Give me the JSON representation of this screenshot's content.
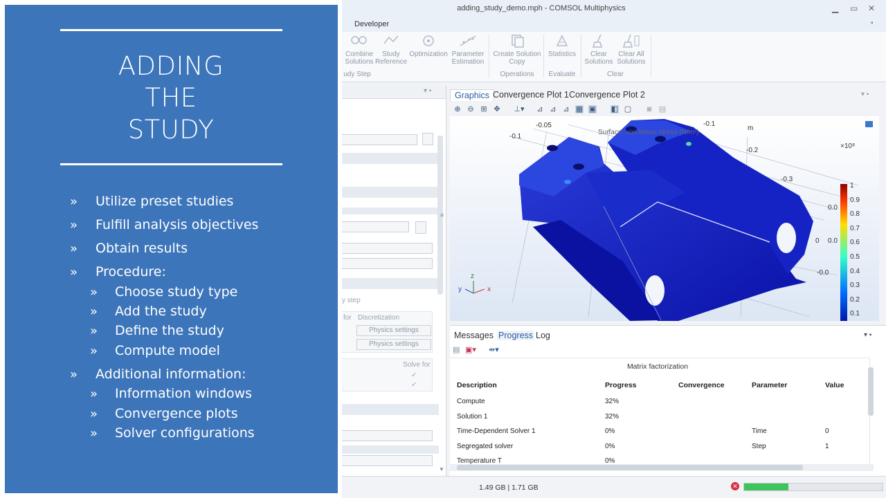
{
  "slide": {
    "title_lines": [
      "ADDING",
      "THE",
      "STUDY"
    ],
    "bullets": [
      {
        "text": "Utilize preset studies",
        "level": 0
      },
      {
        "text": "Fulfill analysis objectives",
        "level": 0
      },
      {
        "text": "Obtain results",
        "level": 0
      },
      {
        "text": "Procedure:",
        "level": 0
      },
      {
        "text": "Choose study type",
        "level": 1
      },
      {
        "text": "Add the study",
        "level": 1
      },
      {
        "text": "Define the study",
        "level": 1
      },
      {
        "text": "Compute model",
        "level": 1
      },
      {
        "text": "Additional information:",
        "level": 0
      },
      {
        "text": "Information windows",
        "level": 1
      },
      {
        "text": "Convergence plots",
        "level": 1
      },
      {
        "text": "Solver configurations",
        "level": 1
      }
    ],
    "bullet_glyph": "»"
  },
  "app": {
    "window_title": "adding_study_demo.mph - COMSOL Multiphysics",
    "ribbon_tab": "Developer",
    "ribbon": {
      "study_step": {
        "group": "udy Step",
        "buttons": [
          "Combine Solutions",
          "Study Reference",
          "Optimization",
          "Parameter Estimation"
        ]
      },
      "operations": {
        "group": "Operations",
        "buttons": [
          "Create Solution Copy"
        ]
      },
      "evaluate": {
        "group": "Evaluate",
        "buttons": [
          "Statistics"
        ]
      },
      "clear": {
        "group": "Clear",
        "buttons": [
          "Clear Solutions",
          "Clear All Solutions"
        ]
      }
    },
    "left_pane": {
      "section_label": "y step",
      "col_for": "for",
      "col_discretization": "Discretization",
      "physics_settings": [
        "Physics settings",
        "Physics settings"
      ],
      "solve_for": "Solve for"
    },
    "graphics": {
      "tabs": [
        "Graphics",
        "Convergence Plot 1",
        "Convergence Plot 2"
      ],
      "active_tab": "Graphics",
      "plot_title": "Surface: von Mises stress (N/m²)",
      "axis_unit": "m",
      "axis_labels": [
        "-0.05",
        "-0.1",
        "-0.1",
        "-0.2",
        "-0.3",
        "0",
        "-0.0",
        "0.0",
        "0.0"
      ],
      "colorbar": {
        "exponent": "×10⁸",
        "ticks": [
          "1",
          "0.9",
          "0.8",
          "0.7",
          "0.6",
          "0.5",
          "0.4",
          "0.3",
          "0.2",
          "0.1"
        ]
      },
      "triad": {
        "x": "x",
        "y": "y",
        "z": "z"
      }
    },
    "progress": {
      "tabs": [
        "Messages",
        "Progress",
        "Log"
      ],
      "active_tab": "Progress",
      "caption": "Matrix factorization",
      "columns": [
        "Description",
        "Progress",
        "Convergence",
        "Parameter",
        "Value"
      ],
      "rows": [
        [
          "Compute",
          "32%",
          "",
          "",
          ""
        ],
        [
          "Solution 1",
          "32%",
          "",
          "",
          ""
        ],
        [
          "Time-Dependent Solver 1",
          "0%",
          "",
          "Time",
          "0"
        ],
        [
          "Segregated solver",
          "0%",
          "",
          "Step",
          "1"
        ],
        [
          "Temperature T",
          "0%",
          "",
          "",
          ""
        ]
      ]
    },
    "status": {
      "memory": "1.49 GB | 1.71 GB",
      "progress_fraction": 0.32
    },
    "colors": {
      "slide_blue": "#3d75ba",
      "accent": "#2a5e9c",
      "progress_green": "#3ec45a"
    }
  }
}
